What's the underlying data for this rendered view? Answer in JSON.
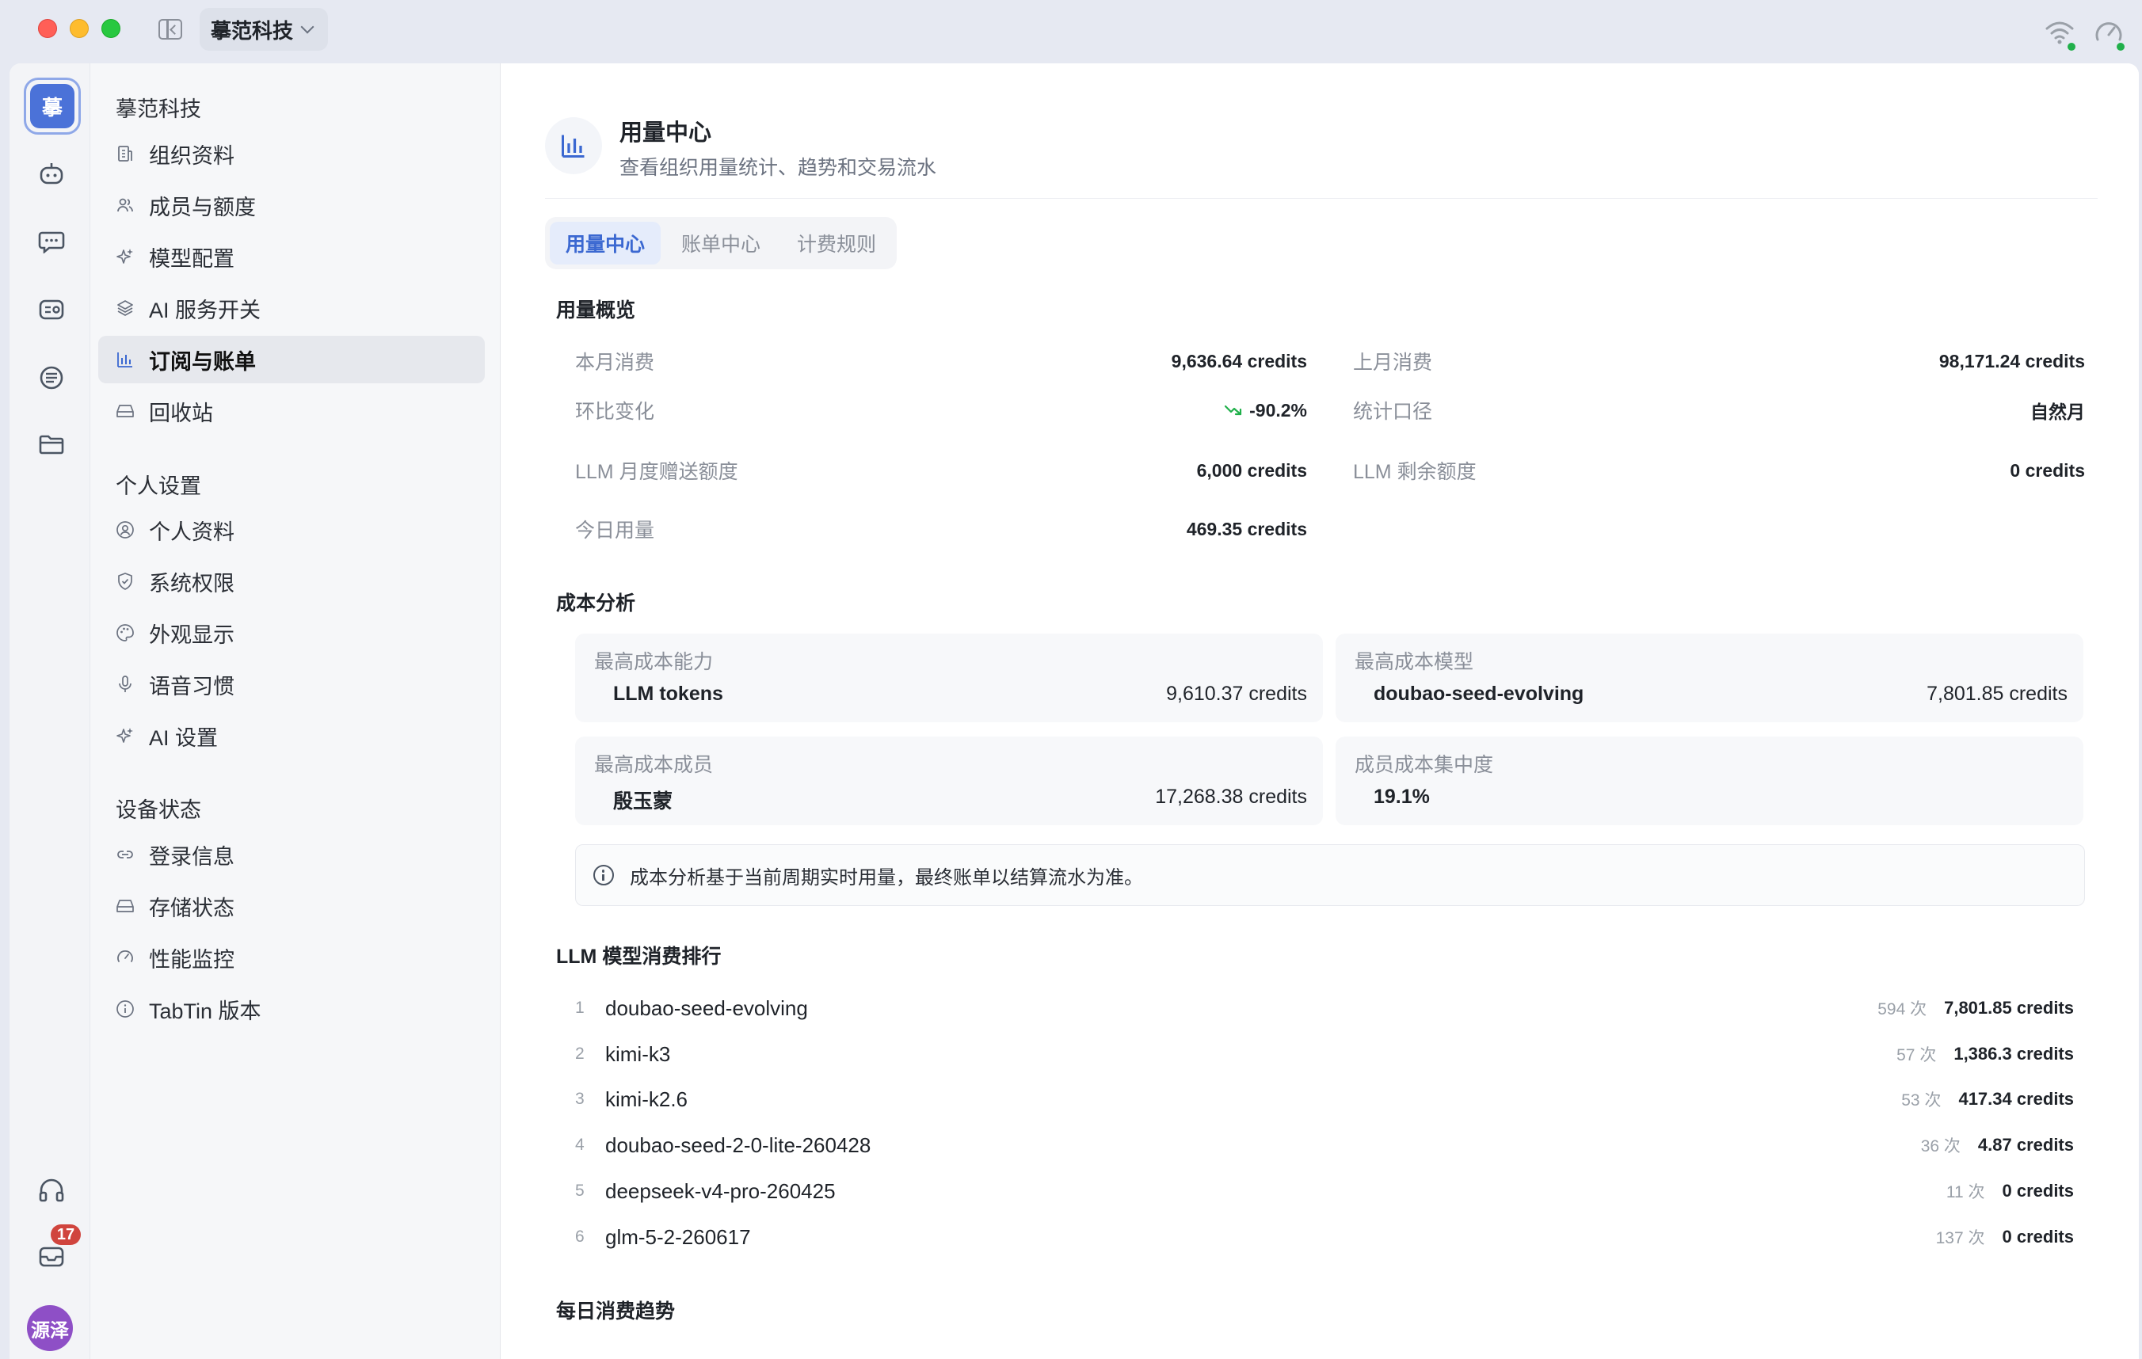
{
  "titlebar": {
    "org_name": "摹范科技"
  },
  "rail": {
    "logo_text": "摹",
    "mail_badge": "17",
    "avatar_text": "源泽"
  },
  "nav": {
    "group_org": "摹范科技",
    "org_items": [
      {
        "label": "组织资料",
        "icon": "building-icon"
      },
      {
        "label": "成员与额度",
        "icon": "users-icon"
      },
      {
        "label": "模型配置",
        "icon": "sparkle-icon"
      },
      {
        "label": "AI 服务开关",
        "icon": "layers-icon"
      },
      {
        "label": "订阅与账单",
        "icon": "bar-chart-icon",
        "active": true
      },
      {
        "label": "回收站",
        "icon": "drive-icon"
      }
    ],
    "group_personal": "个人设置",
    "personal_items": [
      {
        "label": "个人资料",
        "icon": "user-circle-icon"
      },
      {
        "label": "系统权限",
        "icon": "shield-icon"
      },
      {
        "label": "外观显示",
        "icon": "palette-icon"
      },
      {
        "label": "语音习惯",
        "icon": "microphone-icon"
      },
      {
        "label": "AI 设置",
        "icon": "sparkle-icon"
      }
    ],
    "group_device": "设备状态",
    "device_items": [
      {
        "label": "登录信息",
        "icon": "link-icon"
      },
      {
        "label": "存储状态",
        "icon": "drive-icon"
      },
      {
        "label": "性能监控",
        "icon": "gauge-icon"
      },
      {
        "label": "TabTin 版本",
        "icon": "info-icon"
      }
    ]
  },
  "main": {
    "title": "用量中心",
    "subtitle": "查看组织用量统计、趋势和交易流水",
    "tabs": [
      {
        "label": "用量中心",
        "active": true
      },
      {
        "label": "账单中心"
      },
      {
        "label": "计费规则"
      }
    ],
    "overview": {
      "title": "用量概览",
      "this_month_label": "本月消费",
      "this_month_value": "9,636.64 credits",
      "last_month_label": "上月消费",
      "last_month_value": "98,171.24 credits",
      "mom_label": "环比变化",
      "mom_value": "-90.2%",
      "scope_label": "统计口径",
      "scope_value": "自然月",
      "llm_quota_label": "LLM 月度赠送额度",
      "llm_quota_value": "6,000 credits",
      "llm_remaining_label": "LLM 剩余额度",
      "llm_remaining_value": "0 credits",
      "today_label": "今日用量",
      "today_value": "469.35 credits"
    },
    "cost": {
      "title": "成本分析",
      "top_capability_label": "最高成本能力",
      "top_capability_name": "LLM tokens",
      "top_capability_value": "9,610.37 credits",
      "top_model_label": "最高成本模型",
      "top_model_name": "doubao-seed-evolving",
      "top_model_value": "7,801.85 credits",
      "top_member_label": "最高成本成员",
      "top_member_name": "殷玉蒙",
      "top_member_value": "17,268.38 credits",
      "concentration_label": "成员成本集中度",
      "concentration_value": "19.1%",
      "note": "成本分析基于当前周期实时用量，最终账单以结算流水为准。"
    },
    "ranking": {
      "title": "LLM 模型消费排行",
      "rows": [
        {
          "rank": "1",
          "name": "doubao-seed-evolving",
          "count": "594 次",
          "credits": "7,801.85 credits"
        },
        {
          "rank": "2",
          "name": "kimi-k3",
          "count": "57 次",
          "credits": "1,386.3 credits"
        },
        {
          "rank": "3",
          "name": "kimi-k2.6",
          "count": "53 次",
          "credits": "417.34 credits"
        },
        {
          "rank": "4",
          "name": "doubao-seed-2-0-lite-260428",
          "count": "36 次",
          "credits": "4.87 credits"
        },
        {
          "rank": "5",
          "name": "deepseek-v4-pro-260425",
          "count": "11 次",
          "credits": "0 credits"
        },
        {
          "rank": "6",
          "name": "glm-5-2-260617",
          "count": "137 次",
          "credits": "0 credits"
        }
      ]
    },
    "trend_title": "每日消费趋势"
  },
  "colors": {
    "accent": "#3b68d1",
    "logo": "#4b72d8",
    "badge": "#d0453e",
    "avatar": "#8e4fc6",
    "trend_down": "#21b04b",
    "status_dot": "#21b04b"
  }
}
